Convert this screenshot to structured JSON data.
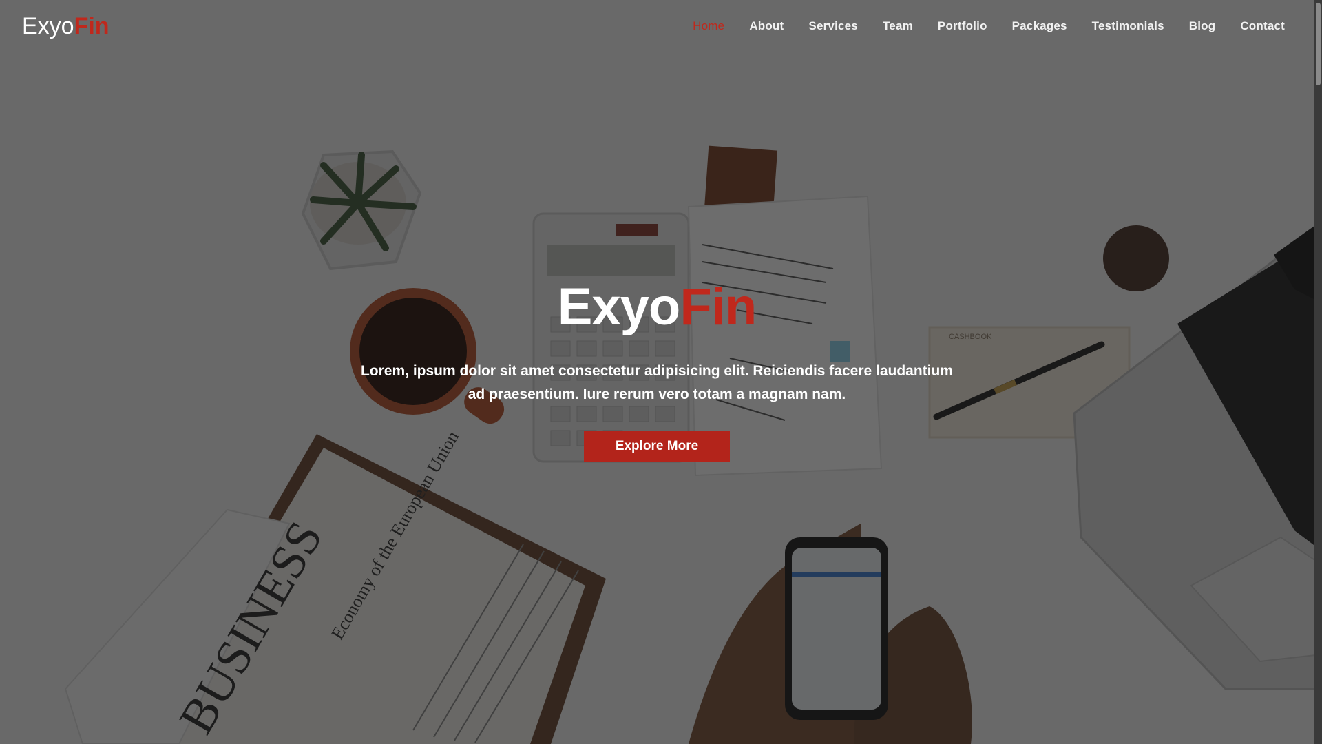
{
  "brand": {
    "name_main": "Exyo",
    "name_accent": "Fin",
    "accent_color": "#c0281c"
  },
  "nav": {
    "items": [
      {
        "label": "Home",
        "active": true
      },
      {
        "label": "About"
      },
      {
        "label": "Services"
      },
      {
        "label": "Team"
      },
      {
        "label": "Portfolio"
      },
      {
        "label": "Packages"
      },
      {
        "label": "Testimonials"
      },
      {
        "label": "Blog"
      },
      {
        "label": "Contact"
      }
    ]
  },
  "hero": {
    "title_main": "Exyo",
    "title_accent": "Fin",
    "text": "Lorem, ipsum dolor sit amet consectetur adipisicing elit. Reiciendis facere laudantium ad praesentium. Iure rerum vero totam a magnam nam.",
    "button_label": "Explore More"
  },
  "background": {
    "newspaper_headline": "BUSINESS",
    "newspaper_subhead": "Economy of the European Union",
    "notebook_label": "CASHBOOK"
  }
}
